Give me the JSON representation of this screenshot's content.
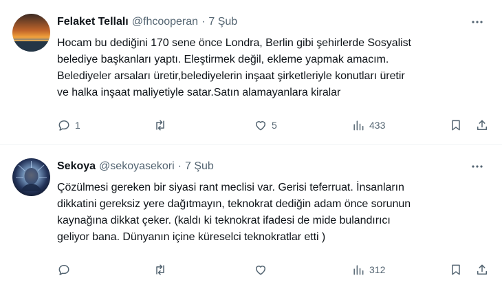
{
  "tweets": [
    {
      "name": "Felaket Tellalı",
      "handle": "@fhcooperan",
      "separator": "·",
      "time": "7 Şub",
      "lines": [
        "Hocam bu dediğini 170 sene önce Londra, Berlin gibi şehirlerde Sosyalist",
        "belediye başkanları yaptı. Eleştirmek değil, ekleme yapmak amacım.",
        "Belediyeler arsaları üretir,belediyelerin inşaat şirketleriyle konutları üretir",
        "ve halka inşaat maliyetiyle satar.Satın alamayanlara kiralar"
      ],
      "replies": "1",
      "retweets": "",
      "likes": "5",
      "views": "433",
      "avatar_icon": "sunset-avatar"
    },
    {
      "name": "Sekoya",
      "handle": "@sekoyasekori",
      "separator": "·",
      "time": "7 Şub",
      "lines": [
        "Çözülmesi gereken bir siyasi rant meclisi var. Gerisi teferruat. İnsanların",
        "dikkatini gereksiz yere dağıtmayın, teknokrat dediğin adam önce sorunun",
        "kaynağına dikkat çeker. (kaldı ki teknokrat ifadesi de mide bulandırıcı",
        "geliyor bana. Dünyanın içine küreselci teknokratlar etti )"
      ],
      "replies": "",
      "retweets": "",
      "likes": "",
      "views": "312",
      "avatar_icon": "glowing-head-avatar"
    }
  ],
  "colors": {
    "text": "#0f1419",
    "secondary": "#536471",
    "divider": "#eff3f4"
  }
}
